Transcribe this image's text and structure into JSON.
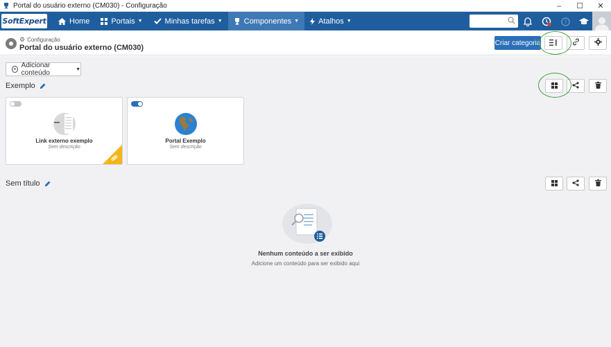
{
  "window": {
    "title": "Portal do usuário externo (CM030) - Configuração",
    "controls": [
      "–",
      "☐",
      "✕"
    ]
  },
  "navbar": {
    "logo_text": "SoftExpert",
    "items": [
      {
        "label": "Home",
        "icon": "home-icon",
        "has_caret": false
      },
      {
        "label": "Portais",
        "icon": "grid-icon",
        "has_caret": true
      },
      {
        "label": "Minhas tarefas",
        "icon": "check-icon",
        "has_caret": true
      },
      {
        "label": "Componentes",
        "icon": "trophy-icon",
        "has_caret": true,
        "active": true
      },
      {
        "label": "Atalhos",
        "icon": "bolt-icon",
        "has_caret": true
      }
    ],
    "search_placeholder": "",
    "notification_badge_color": "#e03b3b"
  },
  "header": {
    "breadcrumb": "Configuração",
    "title": "Portal do usuário externo (CM030)",
    "create_category_label": "Criar categoria"
  },
  "toolbar": {
    "add_content_label": "Adicionar conteúdo"
  },
  "sections": [
    {
      "title": "Exemplo",
      "cards": [
        {
          "name": "Link externo exemplo",
          "description": "Sem descrição",
          "enabled": false,
          "icon": "link-page-icon",
          "corner_badge": "link-icon"
        },
        {
          "name": "Portal Exemplo",
          "description": "Sem descrição",
          "enabled": true,
          "icon": "globe-icon"
        }
      ]
    },
    {
      "title": "Sem título",
      "empty": {
        "title": "Nenhum conteúdo a ser exibido",
        "subtitle": "Adicione um conteúdo para ser exibido aqui"
      }
    }
  ],
  "colors": {
    "navbar": "#1f5e9e",
    "active_tab": "#3f79b5",
    "primary_button": "#2a6fb8",
    "highlight_ring": "#3ea33a",
    "corner_badge": "#f2b51c"
  }
}
